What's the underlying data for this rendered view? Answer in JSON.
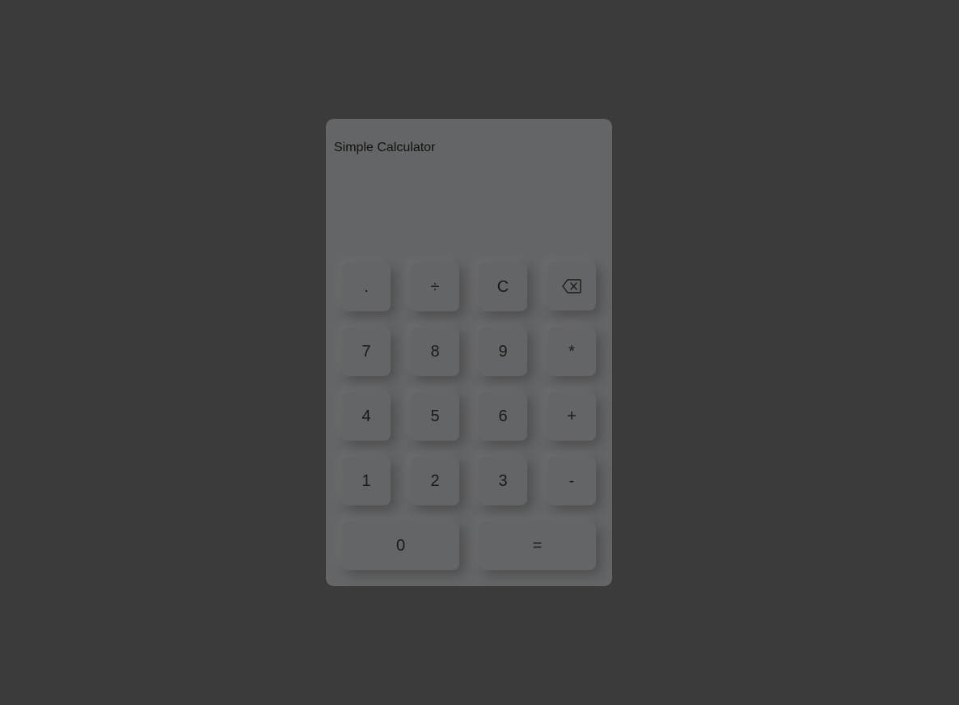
{
  "app": {
    "title": "Simple Calculator",
    "display_value": ""
  },
  "keys": {
    "decimal": ".",
    "divide": "÷",
    "clear": "C",
    "backspace_icon": "backspace-icon",
    "seven": "7",
    "eight": "8",
    "nine": "9",
    "multiply": "*",
    "four": "4",
    "five": "5",
    "six": "6",
    "plus": "+",
    "one": "1",
    "two": "2",
    "three": "3",
    "minus": "-",
    "zero": "0",
    "equals": "="
  },
  "colors": {
    "background": "#3b3b3b",
    "calculator_body": "#646566",
    "key_text": "#1a1a1a"
  }
}
